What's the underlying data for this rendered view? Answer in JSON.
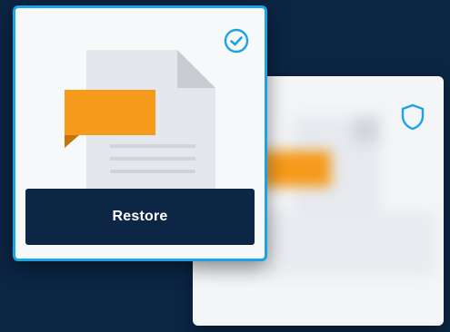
{
  "restore_card": {
    "button_label": "Restore",
    "status_icon": "check-circle-icon"
  },
  "protected_card": {
    "status_icon": "shield-icon"
  },
  "colors": {
    "background": "#0b2544",
    "accent": "#1aa3e6",
    "button": "#0e2645",
    "flag": "#f59a1b",
    "card": "#f7f8fa"
  }
}
